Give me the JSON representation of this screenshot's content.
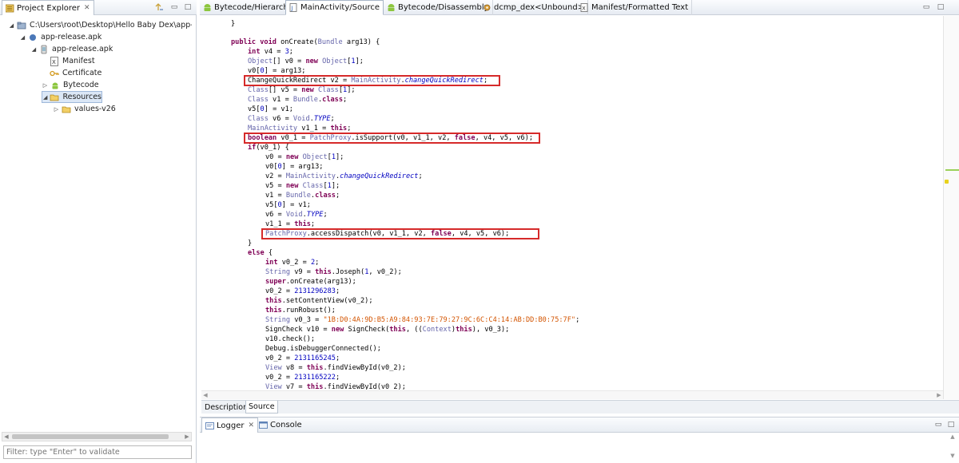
{
  "project_explorer": {
    "title": "Project Explorer",
    "tree": [
      {
        "label": "C:\\Users\\root\\Desktop\\Hello Baby Dex\\app-re"
      },
      {
        "label": "app-release.apk"
      },
      {
        "label": "app-release.apk"
      },
      {
        "label": "Manifest"
      },
      {
        "label": "Certificate"
      },
      {
        "label": "Bytecode"
      },
      {
        "label": "Resources"
      },
      {
        "label": "values-v26"
      }
    ],
    "filter_placeholder": "Filter: type \"Enter\" to validate"
  },
  "editor_tabs": [
    {
      "label": "Bytecode/Hierarchy"
    },
    {
      "label": "MainActivity/Source"
    },
    {
      "label": "Bytecode/Disassembly"
    },
    {
      "label": "dcmp_dex<Unbound>"
    },
    {
      "label": "Manifest/Formatted Text"
    }
  ],
  "code_lines": [
    "}",
    "public void onCreate(Bundle arg13) {",
    "int v4 = 3;",
    "Object[] v0 = new Object[1];",
    "v0[0] = arg13;",
    "ChangeQuickRedirect v2 = MainActivity.changeQuickRedirect;",
    "Class[] v5 = new Class[1];",
    "Class v1 = Bundle.class;",
    "v5[0] = v1;",
    "Class v6 = Void.TYPE;",
    "MainActivity v1_1 = this;",
    "boolean v0_1 = PatchProxy.isSupport(v0, v1_1, v2, false, v4, v5, v6);",
    "if(v0_1) {",
    "v0 = new Object[1];",
    "v0[0] = arg13;",
    "v2 = MainActivity.changeQuickRedirect;",
    "v5 = new Class[1];",
    "v1 = Bundle.class;",
    "v5[0] = v1;",
    "v6 = Void.TYPE;",
    "v1_1 = this;",
    "PatchProxy.accessDispatch(v0, v1_1, v2, false, v4, v5, v6);",
    "}",
    "else {",
    "int v0_2 = 2;",
    "String v9 = this.Joseph(1, v0_2);",
    "super.onCreate(arg13);",
    "v0_2 = 2131296283;",
    "this.setContentView(v0_2);",
    "this.runRobust();",
    "String v0_3 = \"1B:D0:4A:9D:B5:A9:84:93:7E:79:27:9C:6C:C4:14:AB:DD:B0:75:7F\";",
    "SignCheck v10 = new SignCheck(this, ((Context)this), v0_3);",
    "v10.check();",
    "Debug.isDebuggerConnected();",
    "v0_2 = 2131165245;",
    "View v8 = this.findViewById(v0_2);",
    "v0_2 = 2131165222;",
    "View v7 = this.findViewById(v0_2);"
  ],
  "bottom_tabs": [
    {
      "label": "Description"
    },
    {
      "label": "Source"
    }
  ],
  "logger_tabs": [
    {
      "label": "Logger"
    },
    {
      "label": "Console"
    }
  ],
  "colors": {
    "highlight_box": "#d62a2a",
    "keyword": "#7f0055",
    "type": "#6464aa",
    "string": "#d35400"
  }
}
